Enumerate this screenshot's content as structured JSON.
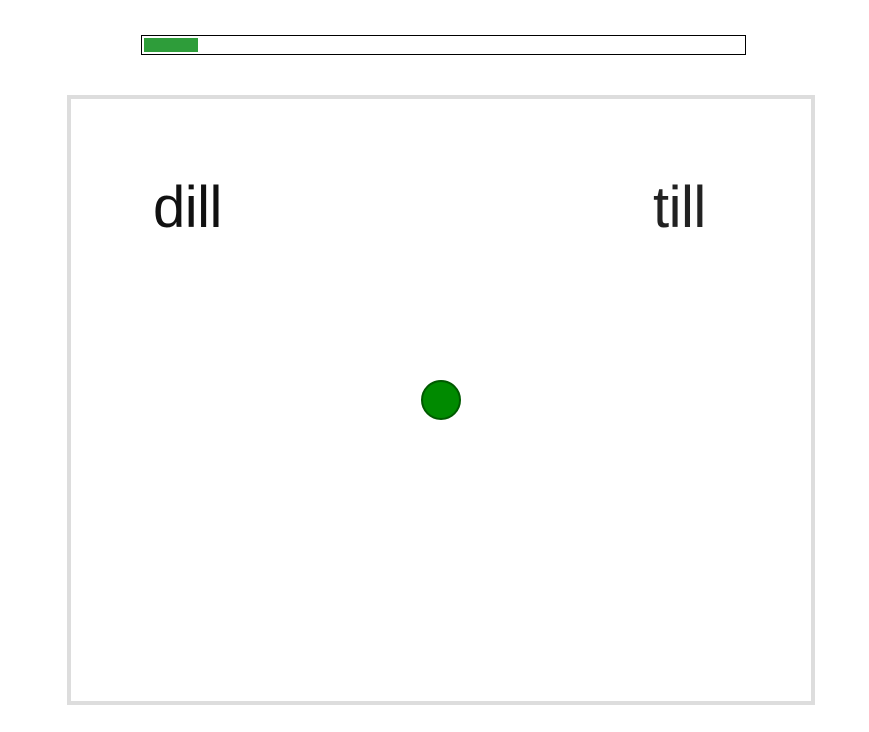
{
  "progress": {
    "value": 0.09,
    "fill_color": "#2e9d3a"
  },
  "stage": {
    "left_word": "dill",
    "right_word": "till",
    "dot_color": "#008a00",
    "border_color": "#dddddd"
  }
}
